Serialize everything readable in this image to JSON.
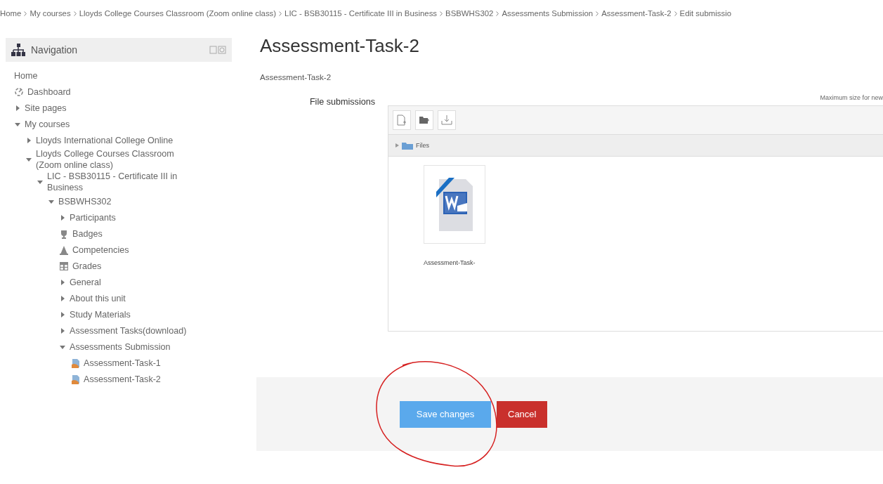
{
  "breadcrumb": [
    "Home",
    "My courses",
    "Lloyds College Courses Classroom (Zoom online class)",
    "LIC - BSB30115 - Certificate III in Business",
    "BSBWHS302",
    "Assessments Submission",
    "Assessment-Task-2",
    "Edit submissio"
  ],
  "navigation": {
    "title": "Navigation",
    "items": [
      {
        "label": "Home",
        "kind": "plain"
      },
      {
        "label": "Dashboard",
        "kind": "dashboard"
      },
      {
        "label": "Site pages",
        "kind": "branch",
        "expanded": false
      },
      {
        "label": "My courses",
        "kind": "branch",
        "expanded": true,
        "children": [
          {
            "label": "Lloyds International College Online",
            "kind": "branch",
            "expanded": false
          },
          {
            "label": "Lloyds College Courses Classroom (Zoom online class)",
            "kind": "branch",
            "expanded": true,
            "children": [
              {
                "label": "LIC - BSB30115 - Certificate III in Business",
                "kind": "branch",
                "expanded": true,
                "children": [
                  {
                    "label": "BSBWHS302",
                    "kind": "branch",
                    "expanded": true,
                    "children": [
                      {
                        "label": "Participants",
                        "kind": "branch",
                        "expanded": false
                      },
                      {
                        "label": "Badges",
                        "kind": "badges"
                      },
                      {
                        "label": "Competencies",
                        "kind": "competencies"
                      },
                      {
                        "label": "Grades",
                        "kind": "grades"
                      },
                      {
                        "label": "General",
                        "kind": "branch",
                        "expanded": false
                      },
                      {
                        "label": "About this unit",
                        "kind": "branch",
                        "expanded": false
                      },
                      {
                        "label": "Study Materials",
                        "kind": "branch",
                        "expanded": false
                      },
                      {
                        "label": "Assessment Tasks(download)",
                        "kind": "branch",
                        "expanded": false
                      },
                      {
                        "label": "Assessments Submission",
                        "kind": "branch",
                        "expanded": true,
                        "children": [
                          {
                            "label": "Assessment-Task-1",
                            "kind": "assignment"
                          },
                          {
                            "label": "Assessment-Task-2",
                            "kind": "assignment"
                          }
                        ]
                      }
                    ]
                  }
                ]
              }
            ]
          }
        ]
      }
    ]
  },
  "page": {
    "title": "Assessment-Task-2",
    "description": "Assessment-Task-2",
    "field_label": "File submissions",
    "max_size_note": "Maximum size for new",
    "path": "Files",
    "files": [
      {
        "name": "Assessment-Task-",
        "kind": "word"
      }
    ],
    "buttons": [
      {
        "label": "Save changes",
        "kind": "primary"
      },
      {
        "label": "Cancel",
        "kind": "danger"
      }
    ]
  }
}
